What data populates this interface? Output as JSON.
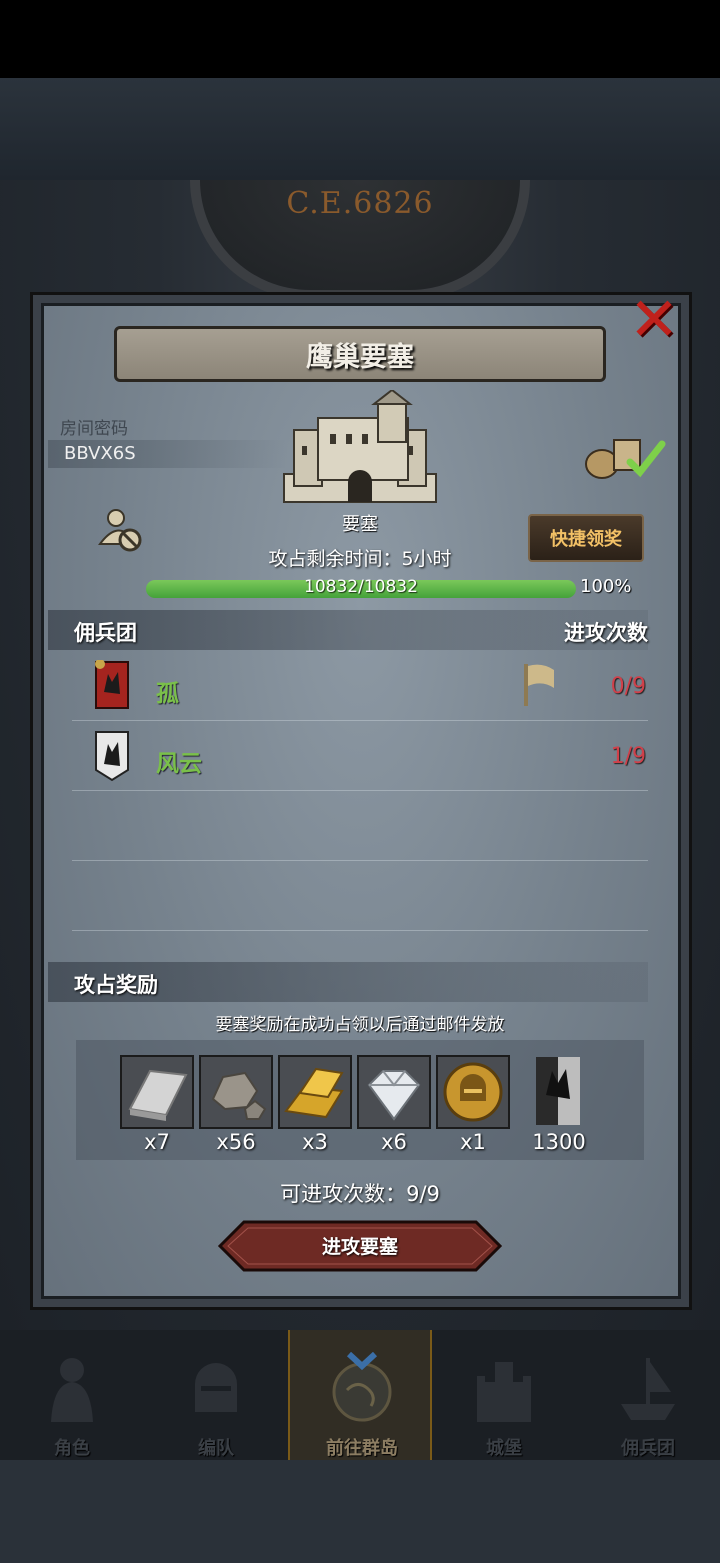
{
  "background": {
    "clock_text": "C.E.6826"
  },
  "dialog": {
    "title": "鹰巢要塞",
    "room_label": "房间密码",
    "room_code": "BBVX6S",
    "building_name": "要塞",
    "quick_claim_label": "快捷领奖",
    "capture_time_text": "攻占剩余时间：5小时",
    "hp": {
      "current": 10832,
      "max": 10832,
      "text": "10832/10832",
      "percent_text": "100%",
      "fill_fraction": 1.0
    },
    "merc_section": {
      "left_label": "佣兵团",
      "right_label": "进攻次数"
    },
    "mercenaries": [
      {
        "name": "孤",
        "attacks": "0/9",
        "banner_color": "#a5241f"
      },
      {
        "name": "风云",
        "attacks": "1/9",
        "banner_color": "#e8e8e8"
      }
    ],
    "reward_section": {
      "label": "攻占奖励",
      "note": "要塞奖励在成功占领以后通过邮件发放"
    },
    "rewards": [
      {
        "icon": "silver-ingot-icon",
        "qty": "x7"
      },
      {
        "icon": "stone-icon",
        "qty": "x56"
      },
      {
        "icon": "gold-bars-icon",
        "qty": "x3"
      },
      {
        "icon": "diamond-icon",
        "qty": "x6"
      },
      {
        "icon": "helmet-coin-icon",
        "qty": "x1"
      },
      {
        "icon": "mercenary-banner-icon",
        "qty": "1300"
      }
    ],
    "attacks_left_text": "可进攻次数：9/9",
    "attack_button_label": "进攻要塞"
  },
  "bottom_nav": [
    {
      "label": "角色",
      "active": false
    },
    {
      "label": "编队",
      "active": false
    },
    {
      "label": "前往群岛",
      "active": true
    },
    {
      "label": "城堡",
      "active": false
    },
    {
      "label": "佣兵团",
      "active": false
    }
  ],
  "colors": {
    "accent_green": "#7ac04a",
    "count_red": "#d0404a",
    "close_red": "#c0211c",
    "quick_gold": "#f2c166"
  }
}
